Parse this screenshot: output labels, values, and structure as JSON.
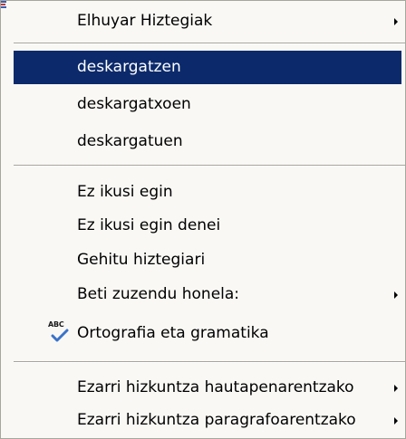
{
  "menu": {
    "items": [
      {
        "label": "Elhuyar Hiztegiak",
        "submenu": true
      },
      {
        "label": "deskargatzen",
        "highlighted": true
      },
      {
        "label": "deskargatxoen"
      },
      {
        "label": "deskargatuen"
      },
      {
        "label": "Ez ikusi egin"
      },
      {
        "label": "Ez ikusi egin denei"
      },
      {
        "label": "Gehitu hiztegiari"
      },
      {
        "label": "Beti zuzendu honela:",
        "submenu": true
      },
      {
        "label": "Ortografia eta gramatika",
        "icon": "abc-spellcheck-icon",
        "icon_text": "ABC"
      },
      {
        "label": "Ezarri hizkuntza hautapenarentzako",
        "submenu": true
      },
      {
        "label": "Ezarri hizkuntza paragrafoarentzako",
        "submenu": true
      }
    ]
  },
  "colors": {
    "menu_background": "#f9f8f5",
    "highlight_background": "#0c2a6b",
    "highlight_text": "#ffffff",
    "separator": "#a7a59a",
    "check_blue": "#3a73c9"
  }
}
